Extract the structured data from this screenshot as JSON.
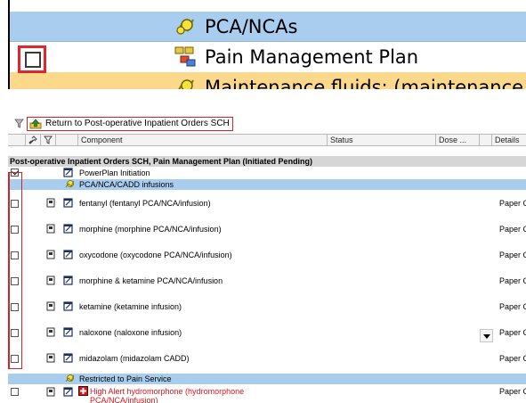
{
  "zoom": {
    "rows": [
      {
        "label": "PCA/NCAs",
        "icon": "pca-icon"
      },
      {
        "label": "Pain Management Plan",
        "icon": "plan-icon"
      },
      {
        "label": "Maintenance fluids: (maintenance rate",
        "icon": "pca-icon"
      }
    ]
  },
  "return_link": {
    "label": "Return to Post-operative Inpatient Orders SCH"
  },
  "header": {
    "component": "Component",
    "status": "Status",
    "dose": "Dose ...",
    "details": "Details"
  },
  "section_title": "Post-operative Inpatient Orders SCH, Pain Management Plan (Initiated Pending)",
  "rows": {
    "powerplan": "PowerPlan Initiation",
    "pca_group": "PCA/NCA/CADD infusions",
    "fentanyl": "fentanyl (fentanyl PCA/NCA/infusion)",
    "morphine": "morphine (morphine PCA/NCA/infusion)",
    "oxycodone": "oxycodone (oxycodone PCA/NCA/infusion)",
    "morphine_ketamine": "morphine & ketamine PCA/NCA/infusion",
    "ketamine": "ketamine (ketamine infusion)",
    "naloxone": "naloxone (naloxone infusion)",
    "midazolam": "midazolam (midazolam CADD)",
    "restricted_group": "Restricted to Pain Service",
    "hydromorphone_1": "High Alert hydromorphone (hydromorphone",
    "hydromorphone_2": "PCA/NCA/infusion)"
  },
  "details_text": "Paper C",
  "colors": {
    "group_blue": "#a8cdef",
    "section_gray": "#d6d6d6",
    "highlight_red": "#d0232a",
    "alert_red": "#e0141b",
    "maintenance_orange": "#fbd88a"
  }
}
